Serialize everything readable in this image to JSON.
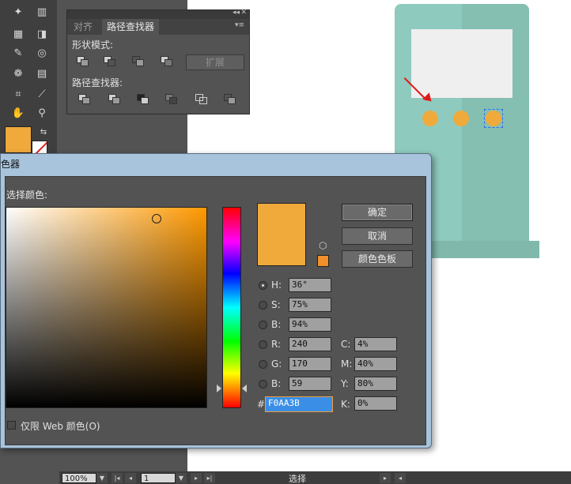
{
  "panel": {
    "tabs": [
      "对齐",
      "路径查找器"
    ],
    "shape_modes_label": "形状模式:",
    "expand_label": "扩展",
    "pathfinders_label": "路径查找器:"
  },
  "status": {
    "zoom": "100%",
    "page": "1",
    "tool": "选择"
  },
  "dialog": {
    "title": "拾色器",
    "select_color_label": "选择颜色:",
    "ok_label": "确定",
    "cancel_label": "取消",
    "swatches_label": "颜色色板",
    "web_only_label": "仅限 Web 颜色(O)",
    "fields": {
      "h": {
        "label": "H:",
        "value": "36°"
      },
      "s": {
        "label": "S:",
        "value": "75%"
      },
      "b": {
        "label": "B:",
        "value": "94%"
      },
      "r": {
        "label": "R:",
        "value": "240"
      },
      "g": {
        "label": "G:",
        "value": "170"
      },
      "bb": {
        "label": "B:",
        "value": "59"
      },
      "c": {
        "label": "C:",
        "value": "4%"
      },
      "m": {
        "label": "M:",
        "value": "40%"
      },
      "y": {
        "label": "Y:",
        "value": "80%"
      },
      "k": {
        "label": "K:",
        "value": "0%"
      },
      "hex": {
        "label": "#",
        "value": "F0AA3B"
      }
    }
  },
  "colors": {
    "selected": "#f0aa3b",
    "machine": "#8fcabe"
  }
}
